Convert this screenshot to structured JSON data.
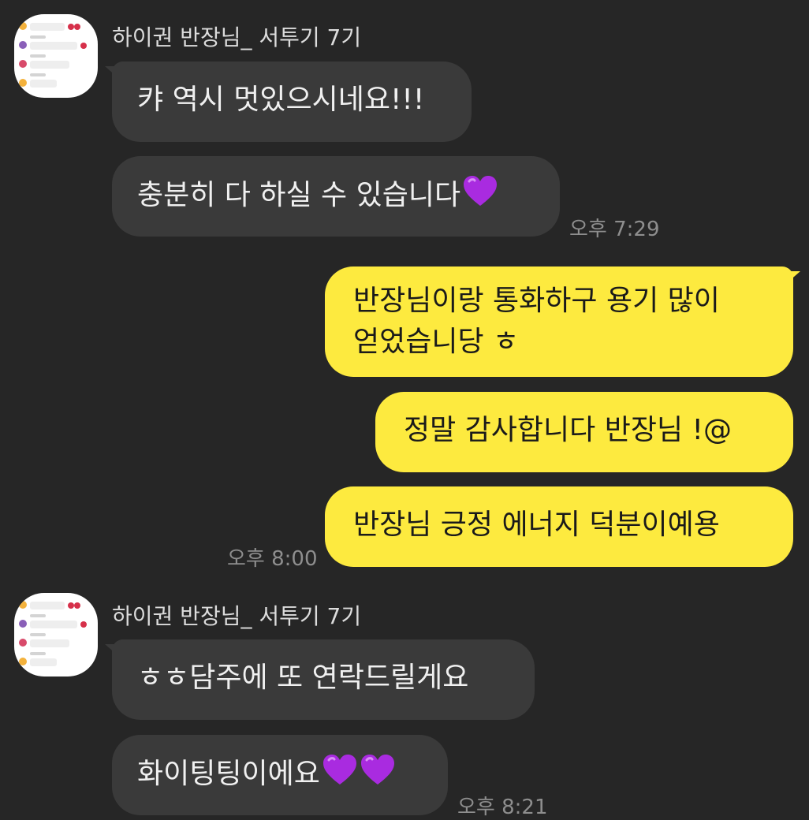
{
  "chat": {
    "groups": [
      {
        "sender": "하이권 반장님_ 서투기 7기",
        "messages": [
          {
            "text": "캬 역시 멋있으시네요!!!"
          },
          {
            "text": "충분히 다 하실 수 있습니다",
            "emoji": [
              "purple-heart"
            ]
          }
        ],
        "time": "오후 7:29"
      },
      {
        "sender": "me",
        "messages": [
          {
            "line1": "반장님이랑 통화하구 용기 많이",
            "line2": "얻었습니당 ㅎ"
          },
          {
            "text": "정말 감사합니다 반장님 !@"
          },
          {
            "text": "반장님 긍정 에너지 덕분이예용"
          }
        ],
        "time": "오후 8:00"
      },
      {
        "sender": "하이권 반장님_ 서투기 7기",
        "messages": [
          {
            "text": "ㅎㅎ담주에 또 연락드릴게요"
          },
          {
            "text": "화이팅팅이에요",
            "emoji": [
              "purple-heart",
              "purple-heart"
            ]
          }
        ],
        "time": "오후 8:21"
      }
    ]
  },
  "colors": {
    "background": "#262626",
    "incoming_bubble": "#3a3a3a",
    "outgoing_bubble": "#fdea3f",
    "heart": "#a92be0"
  }
}
